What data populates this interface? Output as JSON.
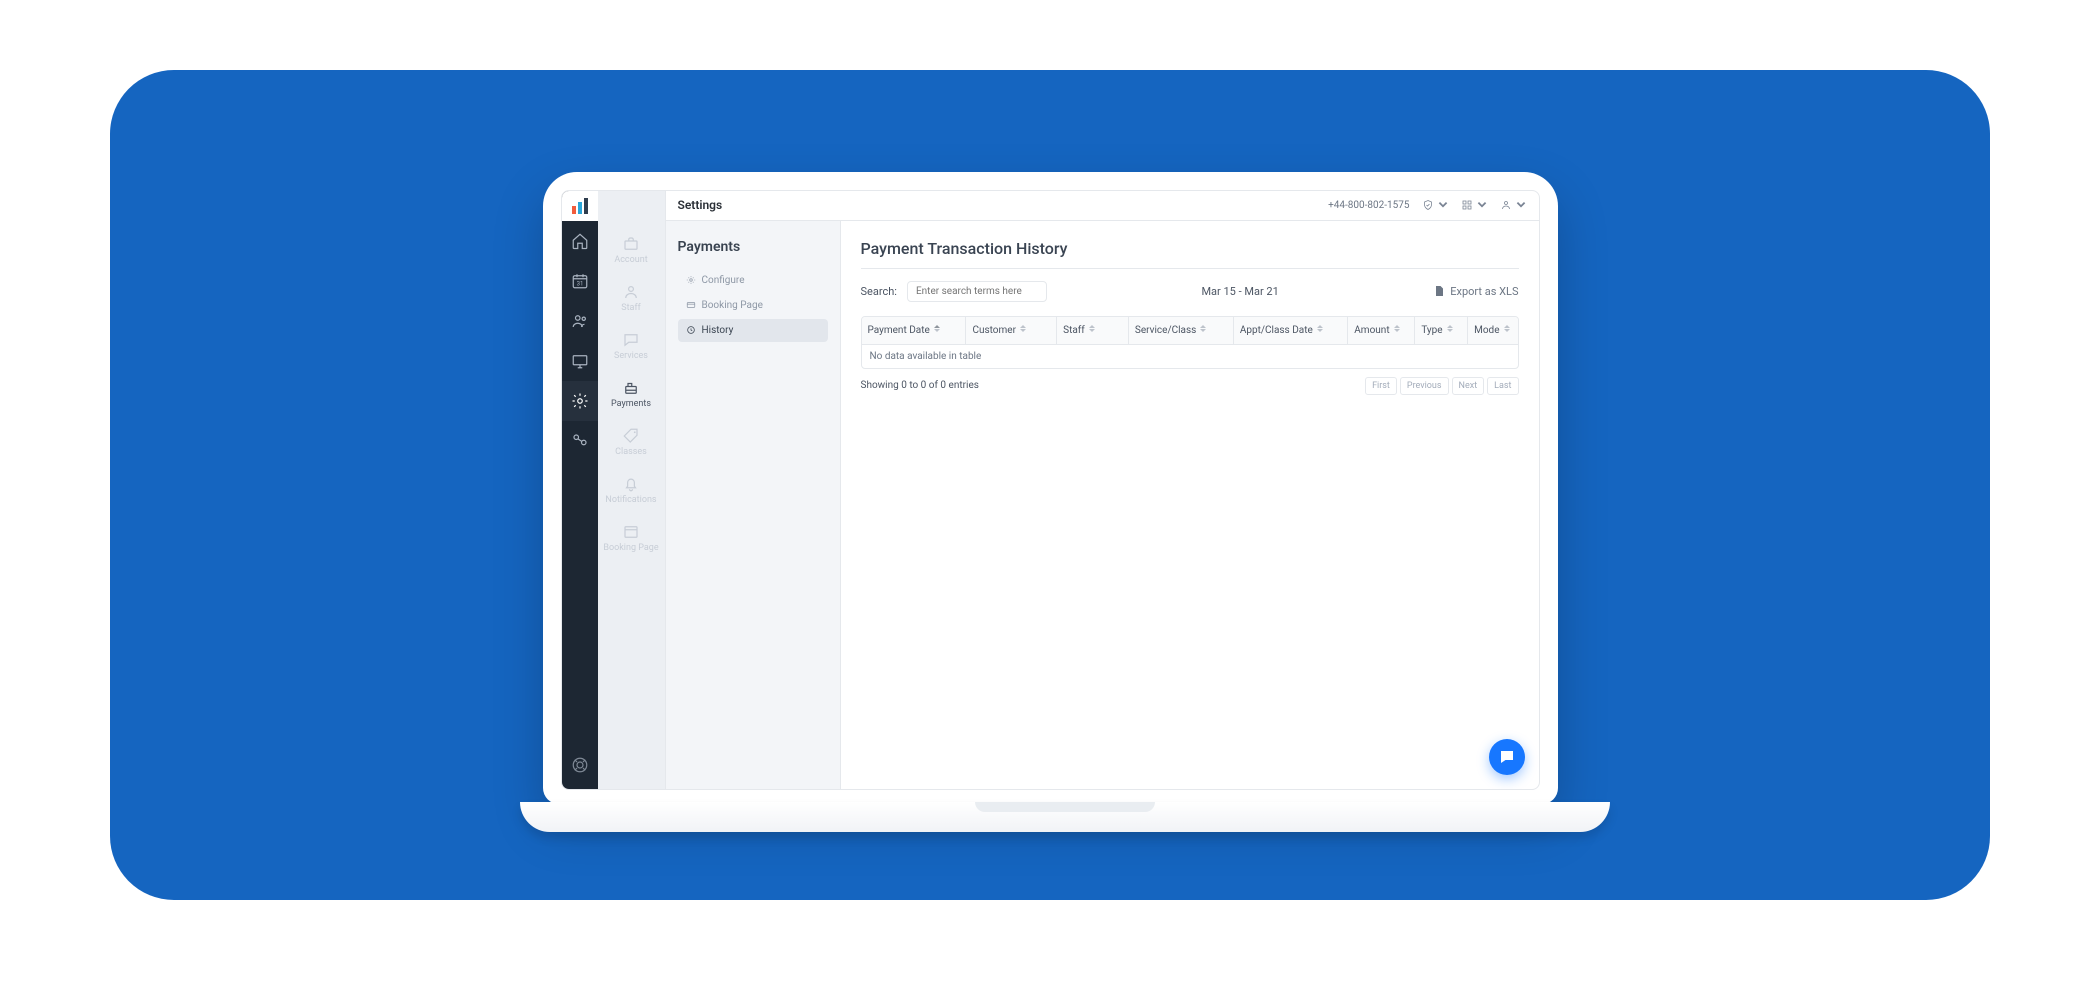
{
  "topbar": {
    "title": "Settings",
    "phone": "+44-800-802-1575"
  },
  "rail": {
    "items": [
      {
        "name": "home",
        "icon": "home"
      },
      {
        "name": "calendar",
        "icon": "calendar"
      },
      {
        "name": "people",
        "icon": "people"
      },
      {
        "name": "monitor",
        "icon": "monitor"
      },
      {
        "name": "settings",
        "icon": "gear",
        "active": true
      },
      {
        "name": "integrations",
        "icon": "atoms"
      }
    ]
  },
  "subnav": {
    "items": [
      {
        "label": "Account",
        "icon": "briefcase"
      },
      {
        "label": "Staff",
        "icon": "person"
      },
      {
        "label": "Services",
        "icon": "chat"
      },
      {
        "label": "Payments",
        "icon": "register",
        "active": true
      },
      {
        "label": "Classes",
        "icon": "tag"
      },
      {
        "label": "Notifications",
        "icon": "bell"
      },
      {
        "label": "Booking Page",
        "icon": "window"
      }
    ]
  },
  "menu3": {
    "title": "Payments",
    "items": [
      {
        "label": "Configure",
        "icon": "gear"
      },
      {
        "label": "Booking Page",
        "icon": "card"
      },
      {
        "label": "History",
        "icon": "clock",
        "active": true
      }
    ]
  },
  "page": {
    "title": "Payment Transaction History",
    "search_label": "Search:",
    "search_placeholder": "Enter search terms here",
    "date_range": "Mar 15 - Mar 21",
    "export_label": "Export as  XLS"
  },
  "columns": [
    {
      "label": "Payment Date",
      "class": "c-pdate",
      "sorted": "asc"
    },
    {
      "label": "Customer",
      "class": "c-cust"
    },
    {
      "label": "Staff",
      "class": "c-staff"
    },
    {
      "label": "Service/Class",
      "class": "c-serv"
    },
    {
      "label": "Appt/Class Date",
      "class": "c-adate"
    },
    {
      "label": "Amount",
      "class": "c-amt"
    },
    {
      "label": "Type",
      "class": "c-type"
    },
    {
      "label": "Mode",
      "class": "c-mode"
    }
  ],
  "empty_text": "No data available in table",
  "showing_text": "Showing 0 to 0 of 0 entries",
  "pager": {
    "first": "First",
    "prev": "Previous",
    "next": "Next",
    "last": "Last"
  }
}
